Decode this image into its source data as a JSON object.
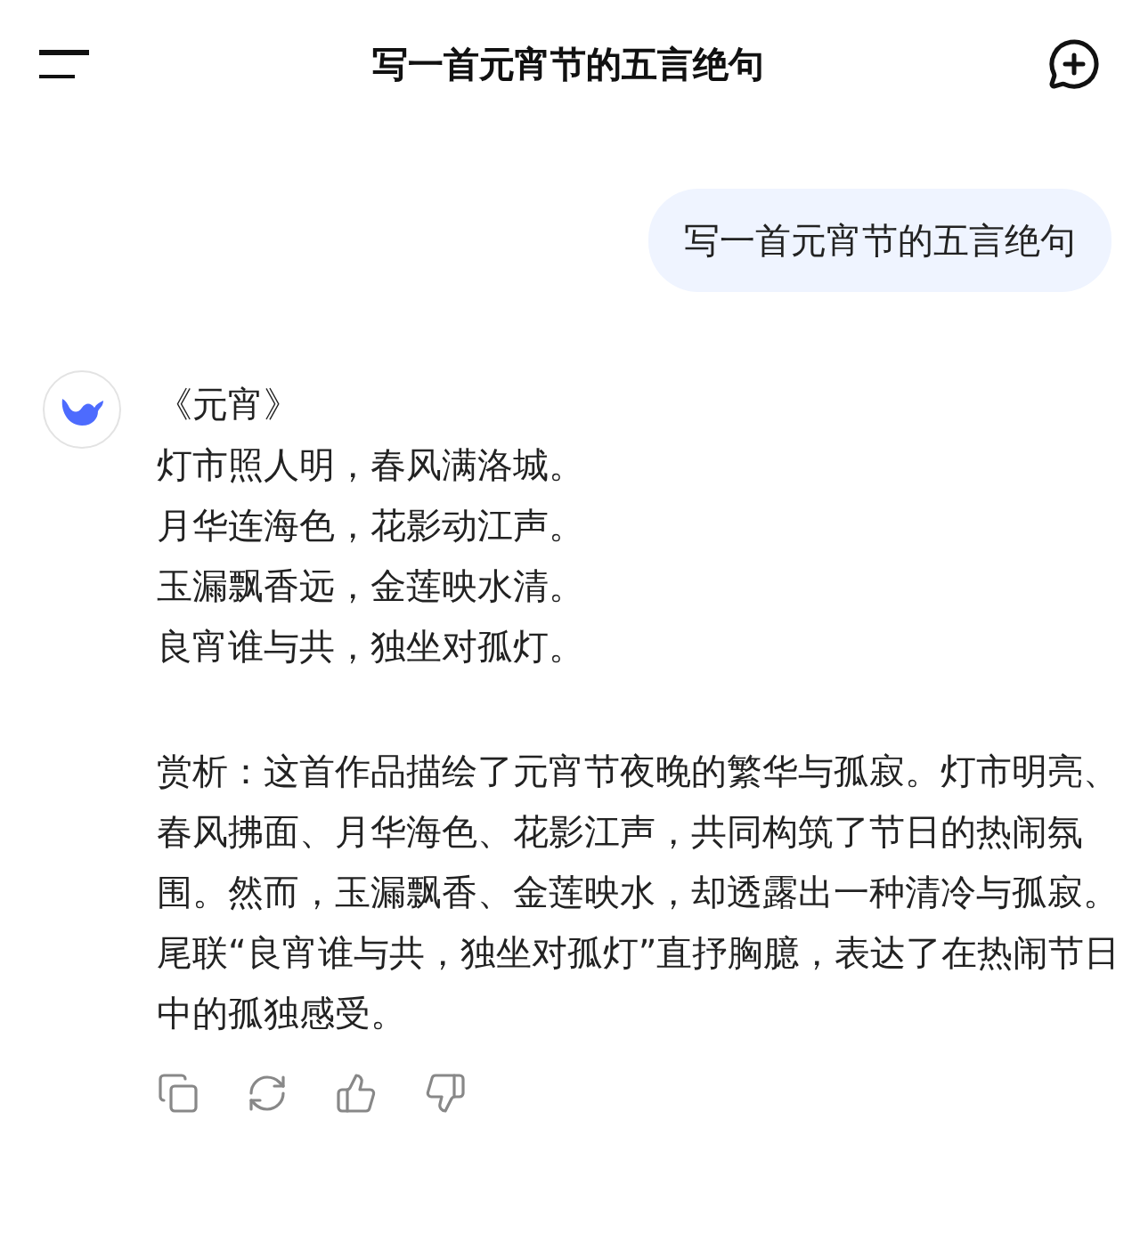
{
  "header": {
    "title": "写一首元宵节的五言绝句"
  },
  "messages": [
    {
      "kind": "user",
      "text": "写一首元宵节的五言绝句"
    },
    {
      "kind": "assistant",
      "title": "《元宵》",
      "lines": [
        "灯市照人明，春风满洛城。",
        "月华连海色，花影动江声。",
        "玉漏飘香远，金莲映水清。",
        "良宵谁与共，独坐对孤灯。"
      ],
      "analysis": "赏析：这首作品描绘了元宵节夜晚的繁华与孤寂。灯市明亮、春风拂面、月华海色、花影江声，共同构筑了节日的热闹氛围。然而，玉漏飘香、金莲映水，却透露出一种清冷与孤寂。尾联“良宵谁与共，独坐对孤灯”直抒胸臆，表达了在热闹节日中的孤独感受。"
    }
  ]
}
